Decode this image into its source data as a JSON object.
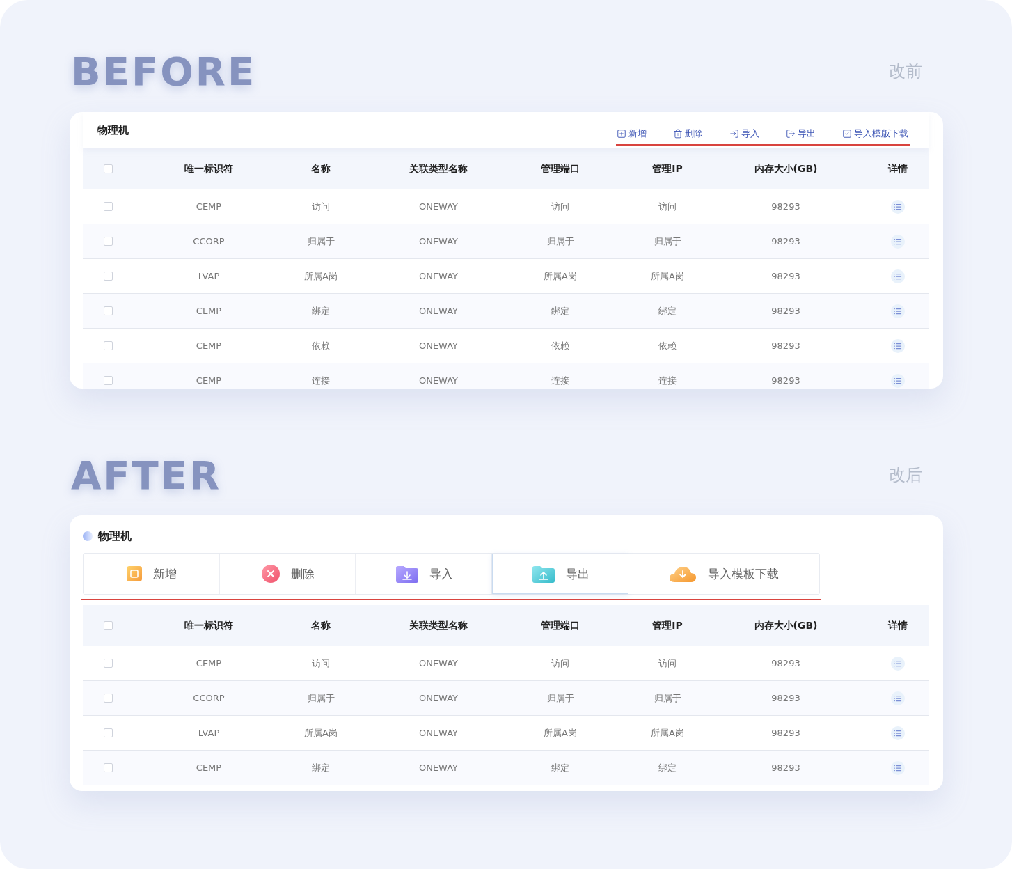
{
  "before": {
    "heading": "BEFORE",
    "caption": "改前",
    "card": {
      "title": "物理机",
      "toolbar": [
        {
          "kind": "add",
          "label": "新增"
        },
        {
          "kind": "delete",
          "label": "删除"
        },
        {
          "kind": "import",
          "label": "导入"
        },
        {
          "kind": "export",
          "label": "导出"
        },
        {
          "kind": "template",
          "label": "导入模版下载"
        }
      ],
      "table": {
        "header_checked": false,
        "columns": [
          "唯一标识符",
          "名称",
          "关联类型名称",
          "管理端口",
          "管理IP",
          "内存大小(GB)",
          "详情"
        ],
        "rows": [
          {
            "checked": false,
            "cells": [
              "CEMP",
              "访问",
              "ONEWAY",
              "访问",
              "访问",
              "98293"
            ]
          },
          {
            "checked": false,
            "cells": [
              "CCORP",
              "归属于",
              "ONEWAY",
              "归属于",
              "归属于",
              "98293"
            ]
          },
          {
            "checked": false,
            "cells": [
              "LVAP",
              "所属A岗",
              "ONEWAY",
              "所属A岗",
              "所属A岗",
              "98293"
            ]
          },
          {
            "checked": false,
            "cells": [
              "CEMP",
              "绑定",
              "ONEWAY",
              "绑定",
              "绑定",
              "98293"
            ]
          },
          {
            "checked": false,
            "cells": [
              "CEMP",
              "依赖",
              "ONEWAY",
              "依赖",
              "依赖",
              "98293"
            ]
          },
          {
            "checked": false,
            "cells": [
              "CEMP",
              "连接",
              "ONEWAY",
              "连接",
              "连接",
              "98293"
            ]
          }
        ]
      }
    }
  },
  "after": {
    "heading": "AFTER",
    "caption": "改后",
    "card": {
      "title": "物理机",
      "toolbar": [
        {
          "kind": "add",
          "label": "新增",
          "selected": false
        },
        {
          "kind": "delete",
          "label": "删除",
          "selected": false
        },
        {
          "kind": "import",
          "label": "导入",
          "selected": false
        },
        {
          "kind": "export",
          "label": "导出",
          "selected": true
        },
        {
          "kind": "template",
          "label": "导入模板下载",
          "selected": false
        }
      ],
      "table": {
        "header_checked": false,
        "columns": [
          "唯一标识符",
          "名称",
          "关联类型名称",
          "管理端口",
          "管理IP",
          "内存大小(GB)",
          "详情"
        ],
        "rows": [
          {
            "checked": false,
            "cells": [
              "CEMP",
              "访问",
              "ONEWAY",
              "访问",
              "访问",
              "98293"
            ]
          },
          {
            "checked": false,
            "cells": [
              "CCORP",
              "归属于",
              "ONEWAY",
              "归属于",
              "归属于",
              "98293"
            ]
          },
          {
            "checked": false,
            "cells": [
              "LVAP",
              "所属A岗",
              "ONEWAY",
              "所属A岗",
              "所属A岗",
              "98293"
            ]
          },
          {
            "checked": false,
            "cells": [
              "CEMP",
              "绑定",
              "ONEWAY",
              "绑定",
              "绑定",
              "98293"
            ]
          }
        ]
      }
    }
  }
}
